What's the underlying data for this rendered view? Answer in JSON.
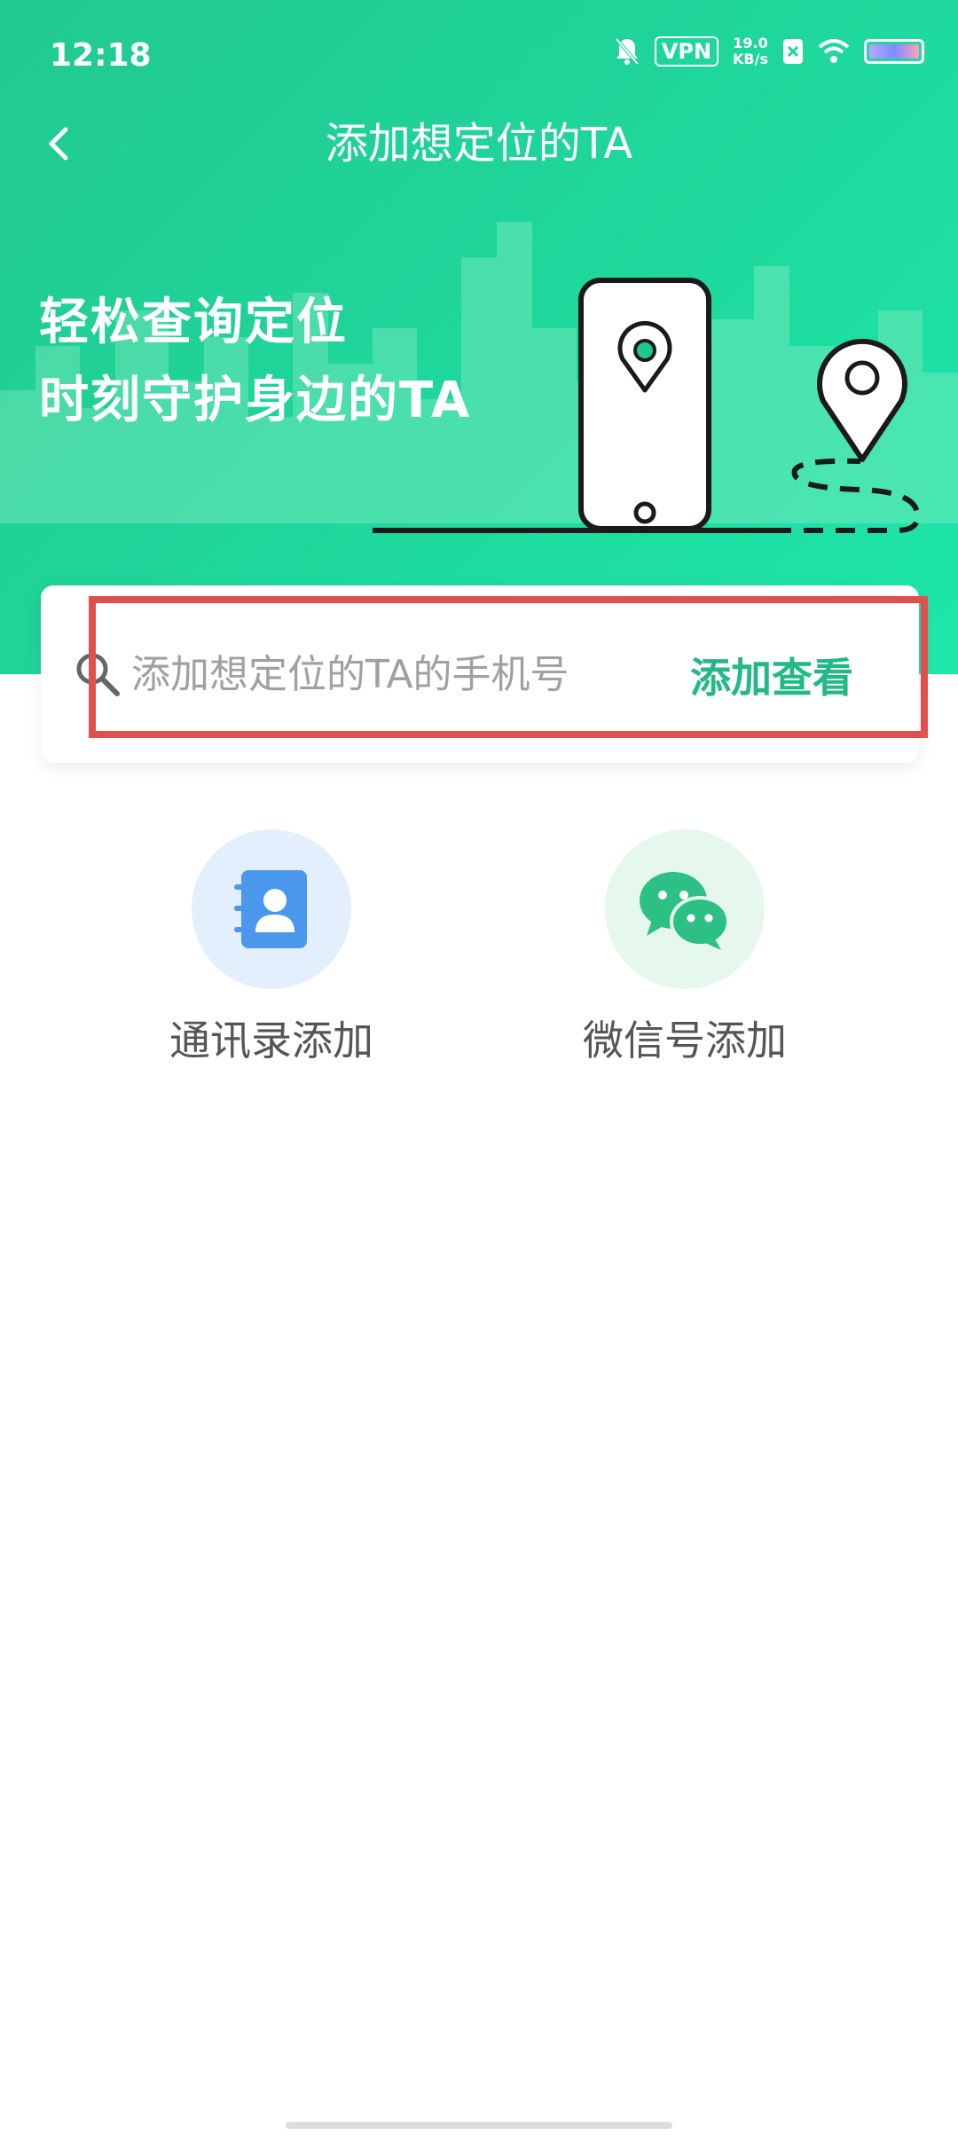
{
  "status_bar": {
    "time": "12:18",
    "vpn": "VPN",
    "speed_value": "19.0",
    "speed_unit": "KB/s"
  },
  "nav": {
    "title": "添加想定位的TA",
    "back_icon": "chevron-left-icon"
  },
  "banner": {
    "line1": "轻松查询定位",
    "line2": "时刻守护身边的TA"
  },
  "search": {
    "placeholder": "添加想定位的TA的手机号",
    "value": "",
    "button_label": "添加查看",
    "icon": "search-icon"
  },
  "options": [
    {
      "label": "通讯录添加",
      "icon": "contacts-book-icon"
    },
    {
      "label": "微信号添加",
      "icon": "wechat-icon"
    }
  ],
  "colors": {
    "header_green": "#22c98f",
    "accent_green": "#22b985",
    "highlight_red": "#e0504f"
  }
}
